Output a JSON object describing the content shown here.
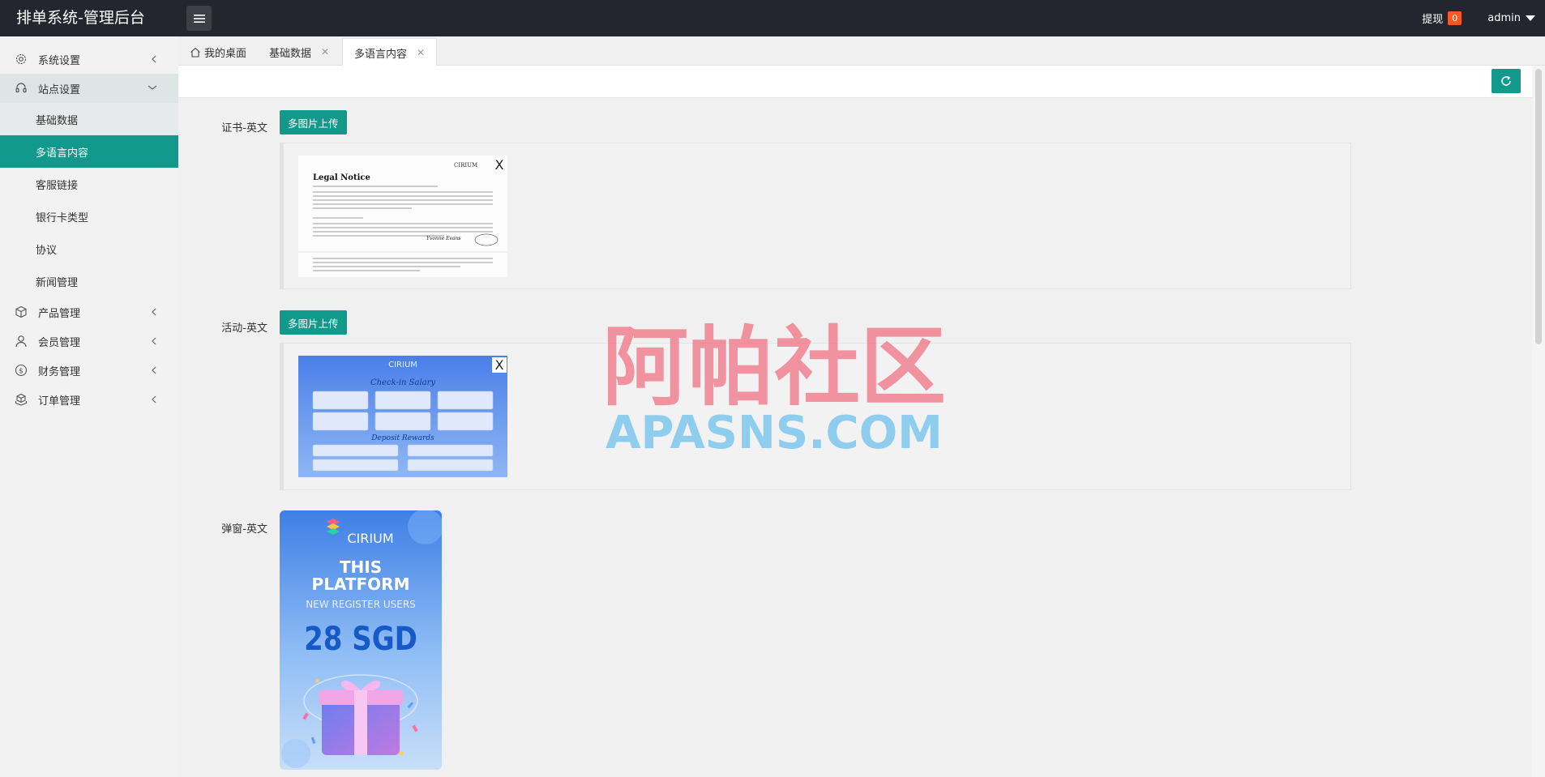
{
  "app": {
    "title": "排单系统-管理后台"
  },
  "header": {
    "withdraw_label": "提现",
    "withdraw_count": "0",
    "user_name": "admin"
  },
  "sidebar": {
    "items": [
      {
        "label": "系统设置",
        "icon": "gear-icon"
      },
      {
        "label": "站点设置",
        "icon": "headset-icon",
        "children": [
          {
            "label": "基础数据"
          },
          {
            "label": "多语言内容"
          },
          {
            "label": "客服链接"
          },
          {
            "label": "银行卡类型"
          },
          {
            "label": "协议"
          },
          {
            "label": "新闻管理"
          }
        ]
      },
      {
        "label": "产品管理",
        "icon": "cube-icon"
      },
      {
        "label": "会员管理",
        "icon": "user-icon"
      },
      {
        "label": "财务管理",
        "icon": "dollar-icon"
      },
      {
        "label": "订单管理",
        "icon": "cubes-icon"
      }
    ]
  },
  "tabs": [
    {
      "label": "我的桌面",
      "icon": "home-icon"
    },
    {
      "label": "基础数据",
      "close": "✕"
    },
    {
      "label": "多语言内容",
      "close": "✕"
    }
  ],
  "form": {
    "upload_label": "多图片上传",
    "delete_label": "X",
    "fields": [
      {
        "label": "证书-英文"
      },
      {
        "label": "活动-英文"
      },
      {
        "label": "弹窗-英文"
      }
    ]
  },
  "images": {
    "legal": {
      "brand": "CIRIUM",
      "title": "Legal Notice",
      "signature": "Yvonne Evans"
    },
    "activity": {
      "brand": "CIRIUM",
      "heading": "Check-in Salary",
      "subheading": "Deposit Rewards"
    },
    "popup": {
      "brand": "CIRIUM",
      "line1": "THIS",
      "line2": "PLATFORM",
      "line3": "NEW REGISTER USERS",
      "amount": "28 SGD"
    }
  },
  "watermark": {
    "cn": "阿帕社区",
    "en": "APASNS.COM"
  },
  "colors": {
    "primary": "#119a8c",
    "header": "#23262e",
    "badge": "#ff5722"
  }
}
